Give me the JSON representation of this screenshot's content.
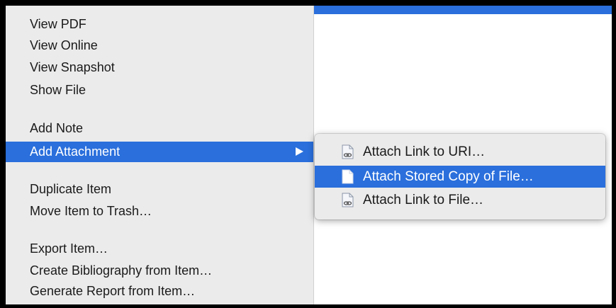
{
  "colors": {
    "highlight": "#2a6fdc",
    "menu_background": "#ebebeb",
    "text": "#1a1a1a"
  },
  "menu": {
    "items": [
      {
        "label": "View PDF"
      },
      {
        "label": "View Online"
      },
      {
        "label": "View Snapshot"
      },
      {
        "label": "Show File"
      },
      {
        "label": "Add Note"
      },
      {
        "label": "Add Attachment",
        "highlighted": true,
        "has_submenu": true
      },
      {
        "label": "Duplicate Item"
      },
      {
        "label": "Move Item to Trash…"
      },
      {
        "label": "Export Item…"
      },
      {
        "label": "Create Bibliography from Item…"
      },
      {
        "label": "Generate Report from Item…"
      }
    ],
    "submenu_arrow_icon": "triangle-right-icon"
  },
  "submenu": {
    "items": [
      {
        "label": "Attach Link to URI…",
        "icon": "link-file-icon"
      },
      {
        "label": "Attach Stored Copy of File…",
        "icon": "document-icon",
        "highlighted": true
      },
      {
        "label": "Attach Link to File…",
        "icon": "link-file-icon"
      }
    ]
  }
}
